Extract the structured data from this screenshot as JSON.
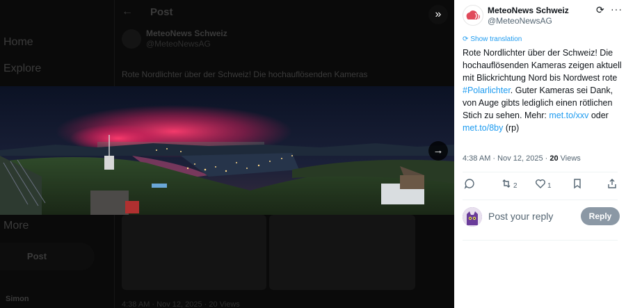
{
  "background": {
    "nav": [
      "Home",
      "Explore",
      "More"
    ],
    "post_button": "Post",
    "header_title": "Post",
    "author_name": "MeteoNews Schweiz",
    "author_handle": "@MeteoNewsAG",
    "text_snippet": "Rote Nordlichter über der Schweiz! Die hochauflösenden Kameras",
    "time_snippet": "4:38 AM · Nov 12, 2025 · 20 Views",
    "sidebar_user": "Simon"
  },
  "tweet": {
    "author_name": "MeteoNews Schweiz",
    "author_handle": "@MeteoNewsAG",
    "show_translation": "Show translation",
    "text_1": "Rote Nordlichter über der Schweiz! Die hochauflösenden Kameras zeigen aktuell mit Blickrichtung Nord bis Nordwest rote ",
    "hashtag": "#Polarlichter",
    "text_2": ". Guter Kameras sei Dank, von Auge gibts lediglich einen rötlichen Stich zu sehen. Mehr: ",
    "link_1": "met.to/xxv",
    "text_3": " oder ",
    "link_2": "met.to/8by",
    "text_4": " (rp)",
    "timestamp": "4:38 AM · Nov 12, 2025 · ",
    "views_count": "20",
    "views_label": " Views"
  },
  "actions": {
    "retweets": "2",
    "likes": "1"
  },
  "reply": {
    "placeholder": "Post your reply",
    "button": "Reply"
  },
  "colors": {
    "link": "#1d9bf0",
    "reply_button": "#8b98a5",
    "aurora": "#ff3c6e"
  }
}
